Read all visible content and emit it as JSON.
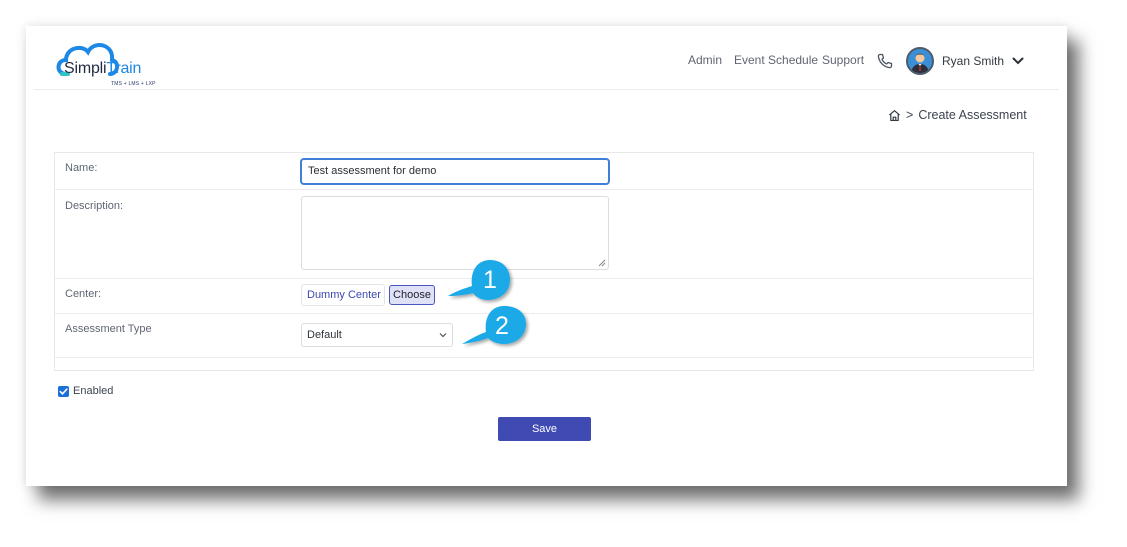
{
  "app": {
    "logo_name": "Simpli",
    "logo_name_accent": "Train",
    "logo_tagline": "TMS + LMS + LXP"
  },
  "header": {
    "nav": [
      "Admin",
      "Event Schedule",
      "Support"
    ],
    "user_name": "Ryan Smith"
  },
  "breadcrumb": {
    "separator": ">",
    "current": "Create Assessment"
  },
  "form": {
    "name_label": "Name:",
    "name_value": "Test assessment for demo",
    "description_label": "Description:",
    "description_value": "",
    "center_label": "Center:",
    "center_value": "Dummy Center",
    "choose_label": "Choose",
    "type_label": "Assessment Type",
    "type_value": "Default",
    "enabled_label": "Enabled",
    "enabled_checked": true,
    "save_label": "Save"
  },
  "callouts": [
    "1",
    "2"
  ],
  "colors": {
    "primary": "#3f4ab3",
    "focus": "#3f7fd8",
    "callout": "#1aa9e8",
    "checkbox": "#1a6fd8"
  }
}
